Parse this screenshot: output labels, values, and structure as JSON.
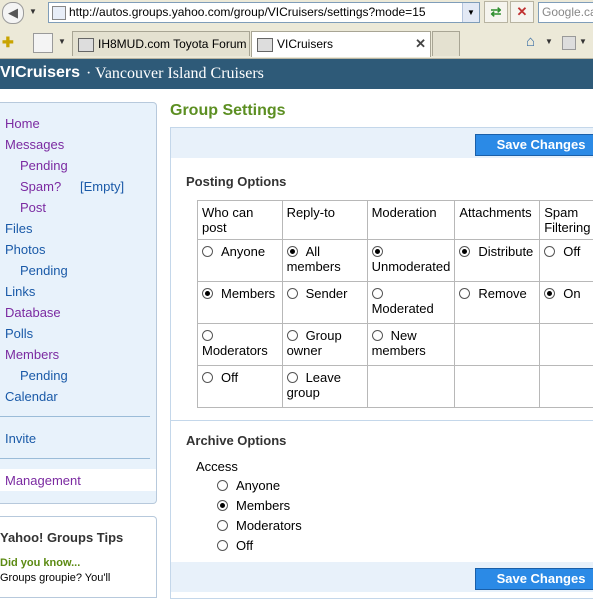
{
  "browser": {
    "address": "http://autos.groups.yahoo.com/group/VICruisers/settings?mode=15",
    "search_placeholder": "Google.ca",
    "tabs": [
      {
        "label": "IH8MUD.com Toyota Forum ..."
      },
      {
        "label": "VICruisers"
      }
    ]
  },
  "header": {
    "group_name": "VICruisers",
    "group_subtitle": "· Vancouver Island Cruisers"
  },
  "sidebar": {
    "home": "Home",
    "messages": "Messages",
    "pending1": "Pending",
    "spam": "Spam?",
    "spam_count": "[Empty]",
    "post": "Post",
    "files": "Files",
    "photos": "Photos",
    "pending2": "Pending",
    "links": "Links",
    "database": "Database",
    "polls": "Polls",
    "members": "Members",
    "pending3": "Pending",
    "calendar": "Calendar",
    "invite": "Invite",
    "management": "Management"
  },
  "tips": {
    "title": "Yahoo! Groups Tips",
    "did_you_know": "Did you know...",
    "body": "Groups groupie? You'll"
  },
  "main": {
    "title": "Group Settings",
    "save_label": "Save Changes",
    "posting_title": "Posting Options",
    "headers": [
      "Who can post",
      "Reply-to",
      "Moderation",
      "Attachments",
      "Spam Filtering"
    ],
    "rows": [
      [
        {
          "label": "Anyone",
          "checked": false
        },
        {
          "label": "All members",
          "checked": true
        },
        {
          "label": "Unmoderated",
          "checked": true
        },
        {
          "label": "Distribute",
          "checked": true
        },
        {
          "label": "Off",
          "checked": false
        }
      ],
      [
        {
          "label": "Members",
          "checked": true
        },
        {
          "label": "Sender",
          "checked": false
        },
        {
          "label": "Moderated",
          "checked": false
        },
        {
          "label": "Remove",
          "checked": false
        },
        {
          "label": "On",
          "checked": true
        }
      ],
      [
        {
          "label": "Moderators",
          "checked": false
        },
        {
          "label": "Group owner",
          "checked": false
        },
        {
          "label": "New members",
          "checked": false
        },
        null,
        null
      ],
      [
        {
          "label": "Off",
          "checked": false
        },
        {
          "label": "Leave group",
          "checked": false
        },
        null,
        null,
        null
      ]
    ],
    "archive_title": "Archive Options",
    "access_label": "Access",
    "access_options": [
      {
        "label": "Anyone",
        "checked": false
      },
      {
        "label": "Members",
        "checked": true
      },
      {
        "label": "Moderators",
        "checked": false
      },
      {
        "label": "Off",
        "checked": false
      }
    ]
  }
}
